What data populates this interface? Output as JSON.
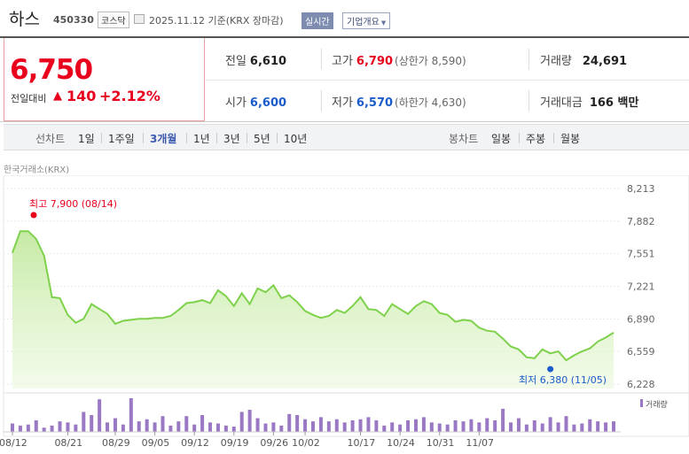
{
  "header": {
    "name": "하스",
    "code": "450330",
    "market": "코스닥",
    "timestamp": "2025.11.12  기준(KRX 장마감)",
    "realtime_label": "실시간",
    "company_label": "기업개요"
  },
  "price": {
    "current": "6,750",
    "change_label": "전일대비",
    "change_value": "140",
    "change_rate": "+2.12%"
  },
  "quote": {
    "prev_close_label": "전일",
    "prev_close": "6,610",
    "high_label": "고가",
    "high": "6,790",
    "upper_limit": "(상한가 8,590)",
    "volume_label": "거래량",
    "volume": "24,691",
    "open_label": "시가",
    "open": "6,600",
    "low_label": "저가",
    "low": "6,570",
    "lower_limit": "(하한가 4,630)",
    "amount_label": "거래대금",
    "amount": "166 백만"
  },
  "periods": {
    "line_title": "선차트",
    "line_items": [
      "1일",
      "1주일",
      "3개월",
      "1년",
      "3년",
      "5년",
      "10년"
    ],
    "active": "3개월",
    "candle_title": "봉차트",
    "candle_items": [
      "일봉",
      "주봉",
      "월봉"
    ]
  },
  "source": "한국거래소(KRX)",
  "colors": {
    "up": "#e8001c",
    "down": "#1a5ccc",
    "line": "#7ed14a",
    "volume": "#9a78c4"
  },
  "chart_data": {
    "type": "area",
    "y_ticks": [
      "8,213",
      "7,882",
      "7,551",
      "7,221",
      "6,890",
      "6,559",
      "6,228"
    ],
    "ylim": [
      6228,
      8213
    ],
    "x_ticks": [
      "08/12",
      "08/21",
      "08/29",
      "09/05",
      "09/12",
      "09/19",
      "09/26",
      "10/02",
      "10/17",
      "10/24",
      "10/31",
      "11/07"
    ],
    "x_tick_index": [
      0,
      7,
      13,
      18,
      23,
      28,
      33,
      37,
      44,
      49,
      54,
      59
    ],
    "price": [
      7560,
      7780,
      7780,
      7700,
      7530,
      7110,
      7100,
      6930,
      6850,
      6890,
      7040,
      6990,
      6940,
      6840,
      6870,
      6880,
      6890,
      6890,
      6900,
      6900,
      6920,
      6980,
      7050,
      7060,
      7080,
      7050,
      7180,
      7120,
      7020,
      7150,
      7040,
      7200,
      7160,
      7230,
      7100,
      7130,
      7060,
      6970,
      6930,
      6900,
      6920,
      6980,
      6950,
      7020,
      7110,
      6990,
      6980,
      6920,
      7040,
      6990,
      6940,
      7020,
      7070,
      7040,
      6950,
      6930,
      6860,
      6880,
      6870,
      6800,
      6770,
      6760,
      6690,
      6610,
      6580,
      6500,
      6490,
      6580,
      6540,
      6560,
      6470,
      6520,
      6560,
      6590,
      6660,
      6700,
      6750
    ],
    "volume": [
      8,
      6,
      7,
      11,
      4,
      6,
      10,
      9,
      7,
      19,
      16,
      31,
      9,
      13,
      7,
      32,
      10,
      12,
      9,
      15,
      6,
      10,
      15,
      7,
      16,
      9,
      8,
      6,
      5,
      19,
      21,
      13,
      8,
      9,
      6,
      17,
      16,
      12,
      10,
      14,
      10,
      12,
      9,
      11,
      12,
      14,
      11,
      6,
      9,
      7,
      11,
      12,
      14,
      9,
      8,
      7,
      11,
      10,
      12,
      9,
      13,
      11,
      22,
      9,
      13,
      7,
      11,
      8,
      14,
      9,
      15,
      7,
      8,
      12,
      10,
      9,
      10
    ],
    "volume_label": "거래량",
    "high_label": "최고",
    "high_value": "7,900 (08/14)",
    "high_index": 2,
    "low_label": "최저",
    "low_value": "6,380 (11/05)",
    "low_index": 68
  }
}
